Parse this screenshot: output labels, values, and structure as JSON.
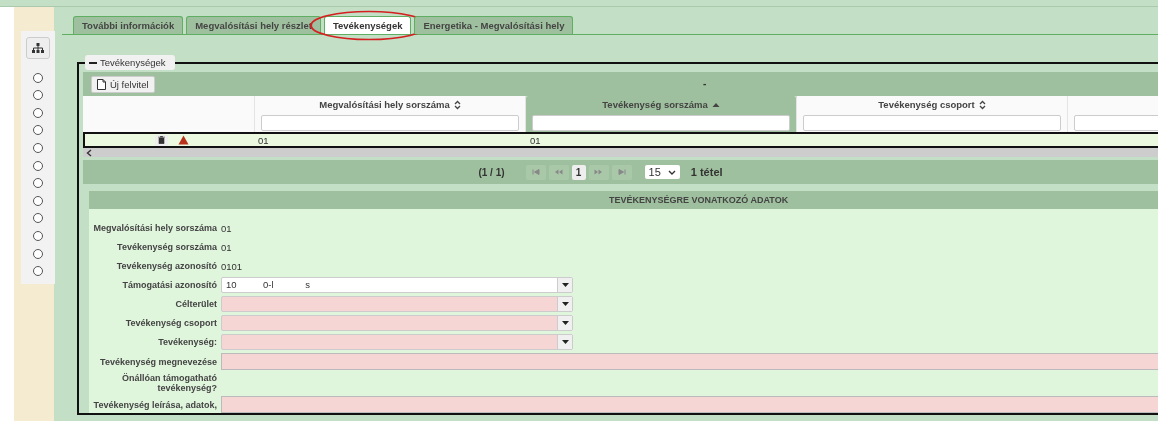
{
  "sidebar": {
    "radios": [
      {
        "selected": false
      },
      {
        "selected": false
      },
      {
        "selected": false
      },
      {
        "selected": false
      },
      {
        "selected": false
      },
      {
        "selected": false
      },
      {
        "selected": false
      },
      {
        "selected": false
      },
      {
        "selected": false
      },
      {
        "selected": false
      },
      {
        "selected": false
      },
      {
        "selected": false
      }
    ]
  },
  "tabs": [
    {
      "label": "További információk",
      "selected": false,
      "circled": false
    },
    {
      "label": "Megvalósítási hely részlet",
      "selected": false,
      "circled": false
    },
    {
      "label": "Tevékenységek",
      "selected": true,
      "circled": true
    },
    {
      "label": "Energetika - Megvalósítási hely",
      "selected": false,
      "circled": false
    }
  ],
  "section": {
    "legend": "Tevékenységek",
    "expanded": true
  },
  "table": {
    "new_button": "Új felvitel",
    "caption": "-",
    "columns": [
      {
        "sortable": false,
        "filter": false
      },
      {
        "label": "Megvalósítási hely sorszáma",
        "sortable": true,
        "sorted": false,
        "filter": true
      },
      {
        "label": "Tevékenység sorszáma",
        "sortable": true,
        "sorted": true,
        "filter": true
      },
      {
        "label": "Tevékenység csoport",
        "sortable": true,
        "sorted": false,
        "filter": true
      },
      {
        "sortable": false,
        "filter": true
      }
    ],
    "rows": [
      {
        "selected": true,
        "warning": true,
        "cells": [
          "01",
          "01"
        ]
      }
    ]
  },
  "paginator": {
    "summary": "(1 / 1)",
    "pages": [
      {
        "label": "1",
        "selected": true
      }
    ],
    "per_page": "15",
    "total": "1 tétel"
  },
  "form": {
    "title": "TEVÉKENYSÉGRE VONATKOZÓ ADATOK",
    "fields": [
      {
        "label": "Megvalósítási hely sorszáma",
        "kind": "text",
        "value": "01"
      },
      {
        "label": "Tevékenység sorszáma",
        "kind": "text",
        "value": "01"
      },
      {
        "label": "Tevékenység azonosító",
        "kind": "text",
        "value": "0101"
      },
      {
        "label": "Támogatási azonosító",
        "kind": "select",
        "value": "10          0-l            s",
        "invalid": false
      },
      {
        "label": "Célterület",
        "kind": "select",
        "invalid": true
      },
      {
        "label": "Tevékenység csoport",
        "kind": "select",
        "invalid": true
      },
      {
        "label": "Tevékenység:",
        "kind": "select",
        "invalid": true
      },
      {
        "label": "Tevékenység megnevezése",
        "kind": "input",
        "invalid": true
      },
      {
        "label": "Önállóan támogatható tevékenység?",
        "kind": "none"
      },
      {
        "label": "Tevékenység leírása, adatok,",
        "kind": "input",
        "invalid": true
      }
    ]
  }
}
